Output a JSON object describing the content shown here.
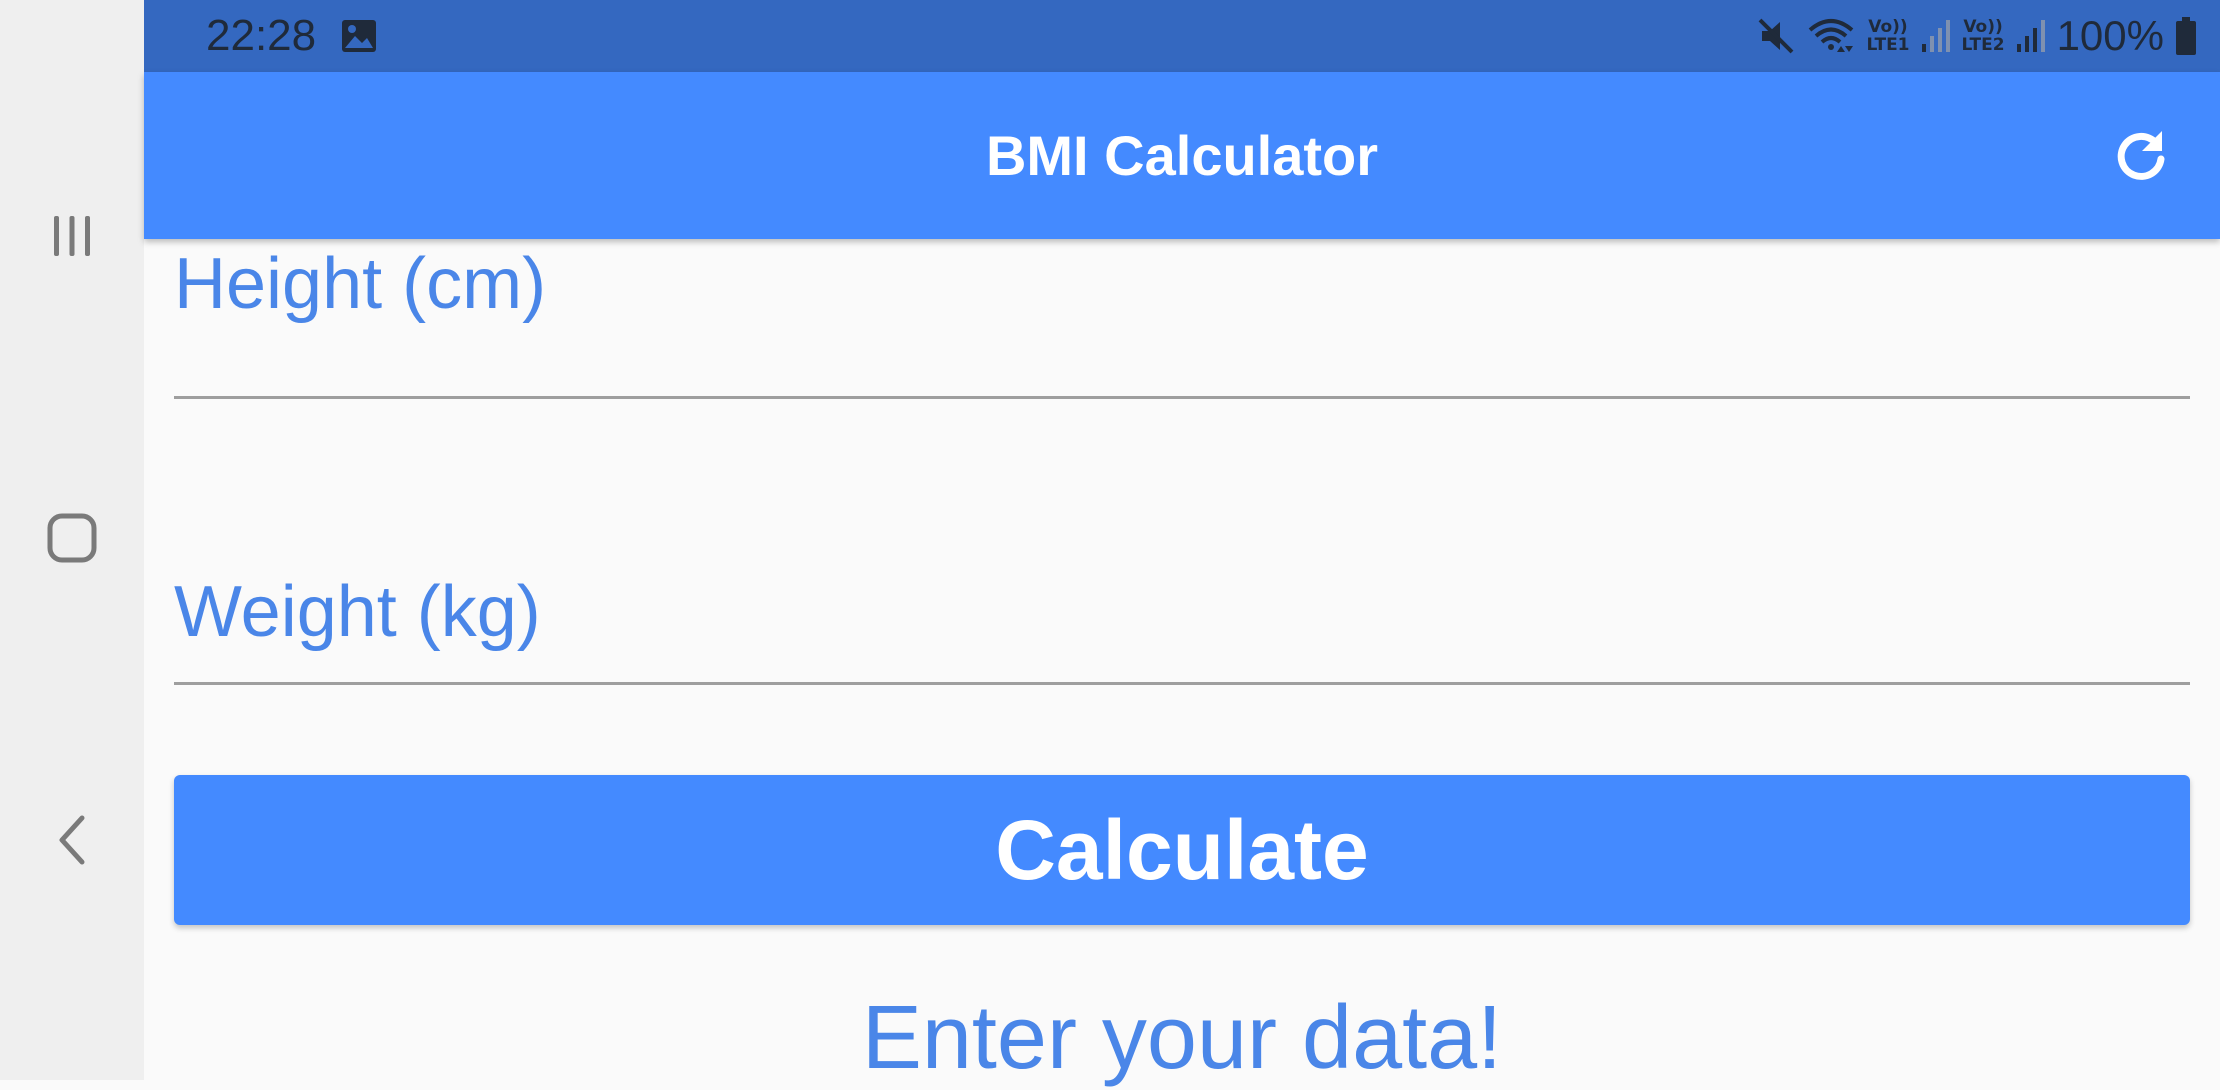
{
  "status_bar": {
    "time": "22:28",
    "sim1": {
      "top": "Vo))",
      "bottom": "LTE1"
    },
    "sim2": {
      "top": "Vo))",
      "bottom": "LTE2"
    },
    "battery": "100%",
    "icons": [
      "image-icon",
      "mute-icon",
      "wifi-icon",
      "signal-icon",
      "battery-icon"
    ]
  },
  "navigation_bar": {
    "icons": [
      "recents-icon",
      "home-icon",
      "back-icon"
    ]
  },
  "app_bar": {
    "title": "BMI Calculator",
    "action_icon": "refresh-icon"
  },
  "form": {
    "height_label": "Height (cm)",
    "height_value": "",
    "weight_label": "Weight (kg)",
    "weight_value": "",
    "calculate_label": "Calculate",
    "result_text": "Enter your data!"
  },
  "colors": {
    "primary": "#448AFF",
    "status_bar": "#3468C0",
    "label": "#4A86E8",
    "background": "#FAFAFA",
    "navbar": "#EFEFEF"
  }
}
